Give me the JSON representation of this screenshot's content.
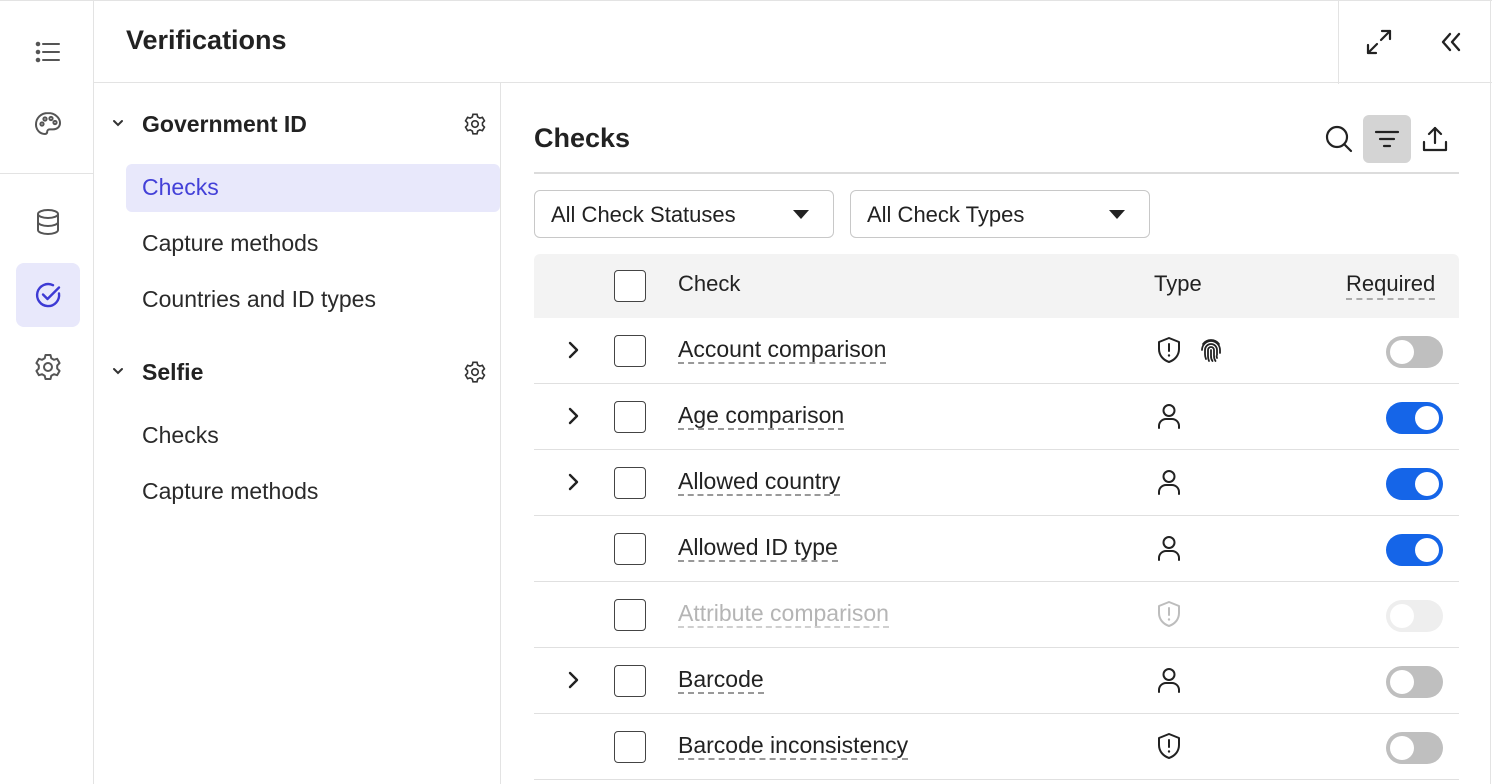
{
  "rail": {
    "items": [
      {
        "icon": "list-icon"
      },
      {
        "icon": "palette-icon"
      },
      {
        "icon": "database-icon"
      },
      {
        "icon": "check-circle-icon",
        "active": true
      },
      {
        "icon": "gear-icon"
      }
    ]
  },
  "topbar": {
    "title": "Verifications",
    "expand_icon": "expand-icon",
    "collapse_icon": "collapse-left-icon"
  },
  "nav": {
    "groups": [
      {
        "label": "Government ID",
        "items": [
          {
            "label": "Checks",
            "active": true
          },
          {
            "label": "Capture methods"
          },
          {
            "label": "Countries and ID types"
          }
        ]
      },
      {
        "label": "Selfie",
        "items": [
          {
            "label": "Checks"
          },
          {
            "label": "Capture methods"
          }
        ]
      }
    ]
  },
  "main": {
    "title": "Checks",
    "filters": {
      "status": "All Check Statuses",
      "type": "All Check Types"
    },
    "columns": {
      "check": "Check",
      "type": "Type",
      "required": "Required"
    },
    "rows": [
      {
        "name": "Account comparison",
        "expandable": true,
        "types": [
          "shield-icon",
          "fingerprint-icon"
        ],
        "required": false,
        "disabled": false
      },
      {
        "name": "Age comparison",
        "expandable": true,
        "types": [
          "person-icon"
        ],
        "required": true,
        "disabled": false
      },
      {
        "name": "Allowed country",
        "expandable": true,
        "types": [
          "person-icon"
        ],
        "required": true,
        "disabled": false
      },
      {
        "name": "Allowed ID type",
        "expandable": false,
        "types": [
          "person-icon"
        ],
        "required": true,
        "disabled": false
      },
      {
        "name": "Attribute comparison",
        "expandable": false,
        "types": [
          "shield-icon"
        ],
        "required": false,
        "disabled": true
      },
      {
        "name": "Barcode",
        "expandable": true,
        "types": [
          "person-icon"
        ],
        "required": false,
        "disabled": false
      },
      {
        "name": "Barcode inconsistency",
        "expandable": false,
        "types": [
          "shield-icon"
        ],
        "required": false,
        "disabled": false
      }
    ]
  },
  "colors": {
    "accent": "#1565e8",
    "nav_active_bg": "#e8e8fb",
    "nav_active_text": "#4340d8"
  }
}
